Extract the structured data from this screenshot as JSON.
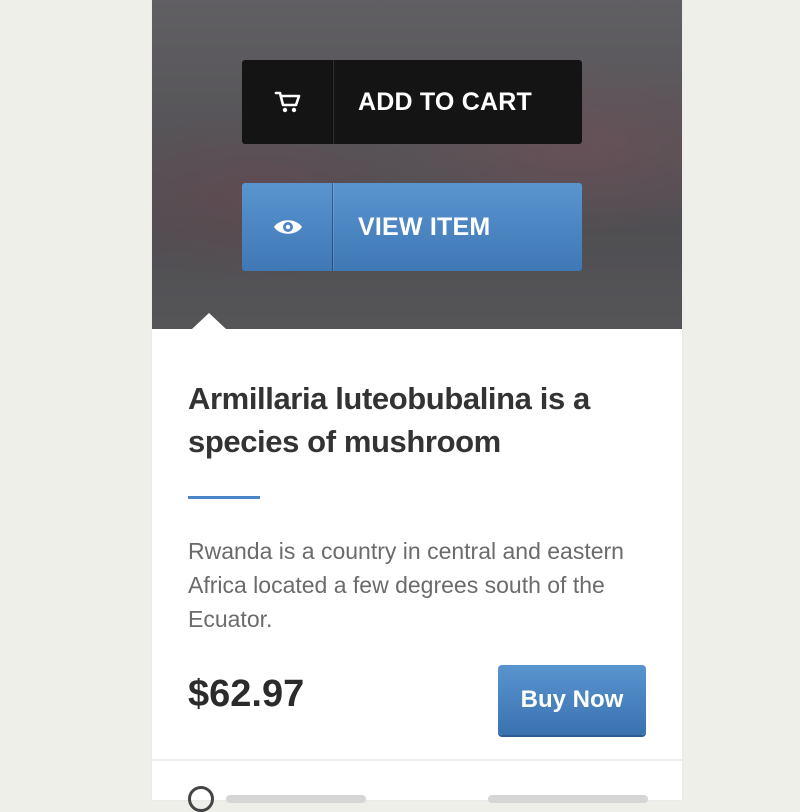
{
  "product": {
    "add_to_cart_label": "ADD TO CART",
    "view_item_label": "VIEW ITEM",
    "title": "Armillaria luteobubalina is a species of mushroom",
    "description": "Rwanda is a country in central and eastern Africa located a few degrees south of the Ecuator.",
    "price": "$62.97",
    "buy_label": "Buy Now"
  },
  "icons": {
    "cart": "cart-icon",
    "view": "eye-icon",
    "footer": "clock-icon"
  },
  "colors": {
    "accent": "#4a86c5",
    "cart_button": "#141414",
    "background": "#efefea"
  }
}
